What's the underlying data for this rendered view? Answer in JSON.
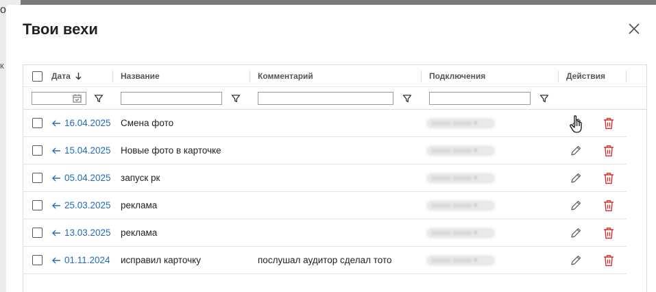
{
  "modal": {
    "title": "Твои вехи"
  },
  "columns": {
    "date": "Дата",
    "name": "Название",
    "comment": "Комментарий",
    "connections": "Подключения",
    "actions": "Действия"
  },
  "rows": [
    {
      "date": "16.04.2025",
      "name": "Смена фото",
      "comment": ""
    },
    {
      "date": "15.04.2025",
      "name": "Новые фото в карточке",
      "comment": ""
    },
    {
      "date": "05.04.2025",
      "name": "запуск рк",
      "comment": ""
    },
    {
      "date": "25.03.2025",
      "name": "реклама",
      "comment": ""
    },
    {
      "date": "13.03.2025",
      "name": "реклама",
      "comment": ""
    },
    {
      "date": "01.11.2024",
      "name": "исправил карточку",
      "comment": "послушал аудитор сделал тото"
    }
  ],
  "colors": {
    "link": "#1f6bbd",
    "delete": "#d0312d",
    "icon": "#555555"
  },
  "icons": {
    "close": "close-icon",
    "sort": "arrow-down-icon",
    "filter": "funnel-icon",
    "calendar": "calendar-icon",
    "rowArrow": "arrow-left-icon",
    "edit": "pencil-icon",
    "delete": "trash-icon",
    "cursor": "hand-pointer-icon"
  }
}
